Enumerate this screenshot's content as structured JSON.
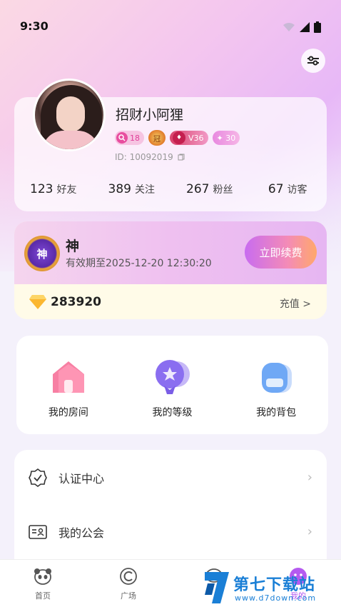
{
  "status_bar": {
    "time": "9:30"
  },
  "profile": {
    "name": "招财小阿狸",
    "badges": {
      "level": "18",
      "crown": "冠",
      "vip": "V36",
      "glory": "30"
    },
    "id_text": "ID: 10092019"
  },
  "stats": [
    {
      "num": "123",
      "label": "好友"
    },
    {
      "num": "389",
      "label": "关注"
    },
    {
      "num": "267",
      "label": "粉丝"
    },
    {
      "num": "67",
      "label": "访客"
    }
  ],
  "vip": {
    "icon_text": "神",
    "title": "神",
    "expire": "有效期至2025-12-20 12:30:20",
    "renew_label": "立即续费"
  },
  "wallet": {
    "balance": "283920",
    "recharge_label": "充值 >"
  },
  "features": [
    {
      "label": "我的房间",
      "icon": "house-icon"
    },
    {
      "label": "我的等级",
      "icon": "level-medal-icon"
    },
    {
      "label": "我的背包",
      "icon": "backpack-icon"
    }
  ],
  "menu": [
    {
      "label": "认证中心",
      "icon": "verify-badge-icon"
    },
    {
      "label": "我的公会",
      "icon": "guild-card-icon"
    }
  ],
  "tabs": [
    {
      "label": "首页",
      "icon": "panda-icon"
    },
    {
      "label": "广场",
      "icon": "square-icon"
    },
    {
      "label": "",
      "icon": "message-icon"
    },
    {
      "label": "我的",
      "icon": "profile-icon"
    }
  ],
  "watermark": {
    "brand": "第七下载站",
    "url": "www.d7down.com"
  },
  "colors": {
    "accent": "#b55af0",
    "renew_start": "#c86cf0",
    "renew_end": "#ffa86b"
  }
}
